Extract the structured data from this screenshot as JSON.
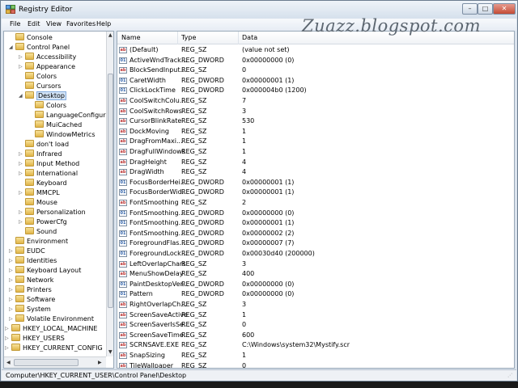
{
  "window": {
    "title": "Registry Editor",
    "watermark": "Zuazz.blogspot.com",
    "controls": {
      "minimize": "–",
      "maximize": "□",
      "close": "✕"
    }
  },
  "menu": [
    "File",
    "Edit",
    "View",
    "Favorites",
    "Help"
  ],
  "tree": [
    {
      "label": "Console",
      "level": 0,
      "expander": ""
    },
    {
      "label": "Control Panel",
      "level": 0,
      "expander": "◢"
    },
    {
      "label": "Accessibility",
      "level": 1,
      "expander": "▷"
    },
    {
      "label": "Appearance",
      "level": 1,
      "expander": "▷"
    },
    {
      "label": "Colors",
      "level": 1,
      "expander": ""
    },
    {
      "label": "Cursors",
      "level": 1,
      "expander": ""
    },
    {
      "label": "Desktop",
      "level": 1,
      "expander": "◢",
      "selected": true
    },
    {
      "label": "Colors",
      "level": 2,
      "expander": ""
    },
    {
      "label": "LanguageConfiguration",
      "level": 2,
      "expander": ""
    },
    {
      "label": "MuiCached",
      "level": 2,
      "expander": ""
    },
    {
      "label": "WindowMetrics",
      "level": 2,
      "expander": ""
    },
    {
      "label": "don't load",
      "level": 1,
      "expander": ""
    },
    {
      "label": "Infrared",
      "level": 1,
      "expander": "▷"
    },
    {
      "label": "Input Method",
      "level": 1,
      "expander": "▷"
    },
    {
      "label": "International",
      "level": 1,
      "expander": "▷"
    },
    {
      "label": "Keyboard",
      "level": 1,
      "expander": ""
    },
    {
      "label": "MMCPL",
      "level": 1,
      "expander": "▷"
    },
    {
      "label": "Mouse",
      "level": 1,
      "expander": ""
    },
    {
      "label": "Personalization",
      "level": 1,
      "expander": "▷"
    },
    {
      "label": "PowerCfg",
      "level": 1,
      "expander": "▷"
    },
    {
      "label": "Sound",
      "level": 1,
      "expander": ""
    },
    {
      "label": "Environment",
      "level": 0,
      "expander": ""
    },
    {
      "label": "EUDC",
      "level": 0,
      "expander": "▷"
    },
    {
      "label": "Identities",
      "level": 0,
      "expander": "▷"
    },
    {
      "label": "Keyboard Layout",
      "level": 0,
      "expander": "▷"
    },
    {
      "label": "Network",
      "level": 0,
      "expander": "▷"
    },
    {
      "label": "Printers",
      "level": 0,
      "expander": "▷"
    },
    {
      "label": "Software",
      "level": 0,
      "expander": "▷"
    },
    {
      "label": "System",
      "level": 0,
      "expander": "▷"
    },
    {
      "label": "Volatile Environment",
      "level": 0,
      "expander": "▷"
    },
    {
      "label": "HKEY_LOCAL_MACHINE",
      "level": -1,
      "expander": "▷"
    },
    {
      "label": "HKEY_USERS",
      "level": -1,
      "expander": "▷"
    },
    {
      "label": "HKEY_CURRENT_CONFIG",
      "level": -1,
      "expander": "▷"
    }
  ],
  "columns": {
    "name": "Name",
    "type": "Type",
    "data": "Data"
  },
  "values": [
    {
      "name": "(Default)",
      "type": "REG_SZ",
      "data": "(value not set)"
    },
    {
      "name": "ActiveWndTrack...",
      "type": "REG_DWORD",
      "data": "0x00000000 (0)"
    },
    {
      "name": "BlockSendInput...",
      "type": "REG_SZ",
      "data": "0"
    },
    {
      "name": "CaretWidth",
      "type": "REG_DWORD",
      "data": "0x00000001 (1)"
    },
    {
      "name": "ClickLockTime",
      "type": "REG_DWORD",
      "data": "0x000004b0 (1200)"
    },
    {
      "name": "CoolSwitchColu...",
      "type": "REG_SZ",
      "data": "7"
    },
    {
      "name": "CoolSwitchRows",
      "type": "REG_SZ",
      "data": "3"
    },
    {
      "name": "CursorBlinkRate",
      "type": "REG_SZ",
      "data": "530"
    },
    {
      "name": "DockMoving",
      "type": "REG_SZ",
      "data": "1"
    },
    {
      "name": "DragFromMaxi...",
      "type": "REG_SZ",
      "data": "1"
    },
    {
      "name": "DragFullWindows",
      "type": "REG_SZ",
      "data": "1"
    },
    {
      "name": "DragHeight",
      "type": "REG_SZ",
      "data": "4"
    },
    {
      "name": "DragWidth",
      "type": "REG_SZ",
      "data": "4"
    },
    {
      "name": "FocusBorderHei...",
      "type": "REG_DWORD",
      "data": "0x00000001 (1)"
    },
    {
      "name": "FocusBorderWid...",
      "type": "REG_DWORD",
      "data": "0x00000001 (1)"
    },
    {
      "name": "FontSmoothing",
      "type": "REG_SZ",
      "data": "2"
    },
    {
      "name": "FontSmoothing...",
      "type": "REG_DWORD",
      "data": "0x00000000 (0)"
    },
    {
      "name": "FontSmoothing...",
      "type": "REG_DWORD",
      "data": "0x00000001 (1)"
    },
    {
      "name": "FontSmoothing...",
      "type": "REG_DWORD",
      "data": "0x00000002 (2)"
    },
    {
      "name": "ForegroundFlas...",
      "type": "REG_DWORD",
      "data": "0x00000007 (7)"
    },
    {
      "name": "ForegroundLock...",
      "type": "REG_DWORD",
      "data": "0x00030d40 (200000)"
    },
    {
      "name": "LeftOverlapChars",
      "type": "REG_SZ",
      "data": "3"
    },
    {
      "name": "MenuShowDelay",
      "type": "REG_SZ",
      "data": "400"
    },
    {
      "name": "PaintDesktopVer...",
      "type": "REG_DWORD",
      "data": "0x00000000 (0)"
    },
    {
      "name": "Pattern",
      "type": "REG_DWORD",
      "data": "0x00000000 (0)"
    },
    {
      "name": "RightOverlapCh...",
      "type": "REG_SZ",
      "data": "3"
    },
    {
      "name": "ScreenSaveActive",
      "type": "REG_SZ",
      "data": "1"
    },
    {
      "name": "ScreenSaverIsSe...",
      "type": "REG_SZ",
      "data": "0"
    },
    {
      "name": "ScreenSaveTime...",
      "type": "REG_SZ",
      "data": "600"
    },
    {
      "name": "SCRNSAVE.EXE",
      "type": "REG_SZ",
      "data": "C:\\Windows\\system32\\Mystify.scr"
    },
    {
      "name": "SnapSizing",
      "type": "REG_SZ",
      "data": "1"
    },
    {
      "name": "TileWallpaper",
      "type": "REG_SZ",
      "data": "0"
    }
  ],
  "status": "Computer\\HKEY_CURRENT_USER\\Control Panel\\Desktop"
}
